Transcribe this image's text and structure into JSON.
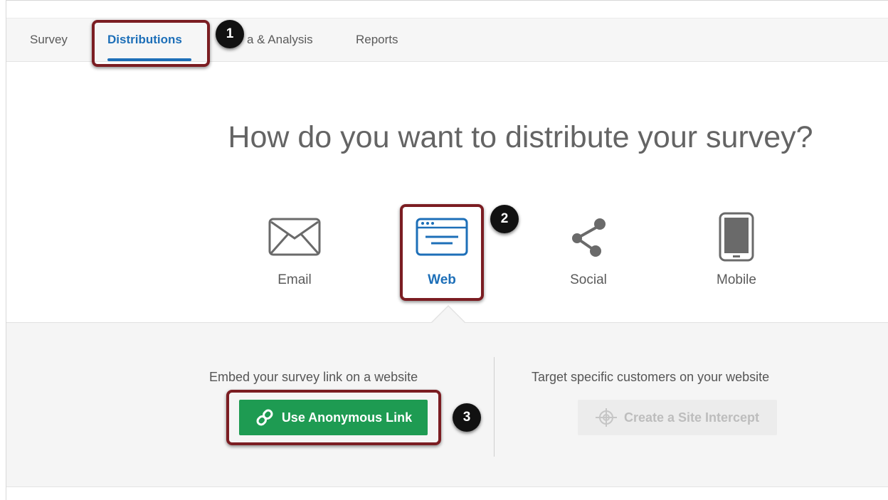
{
  "tabs": {
    "survey": "Survey",
    "distributions": "Distributions",
    "data_analysis_partial": "a & Analysis",
    "reports": "Reports"
  },
  "heading": "How do you want to distribute your survey?",
  "methods": {
    "email": "Email",
    "web": "Web",
    "social": "Social",
    "mobile": "Mobile"
  },
  "web_panel": {
    "embed_caption": "Embed your survey link on a website",
    "anonymous_link_button": "Use Anonymous Link",
    "target_caption": "Target specific customers on your website",
    "site_intercept_button": "Create a Site Intercept"
  },
  "callouts": {
    "step1": "1",
    "step2": "2",
    "step3": "3"
  },
  "colors": {
    "accent": "#1d6fb8",
    "primary_button": "#1e9b52",
    "highlight": "#7b1d22",
    "disabled_text": "#bdbdbd"
  }
}
